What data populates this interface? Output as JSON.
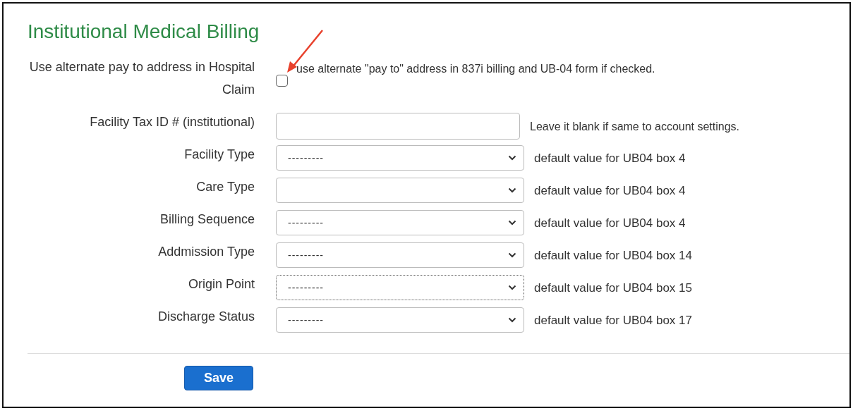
{
  "title": "Institutional Medical Billing",
  "fields": [
    {
      "kind": "checkbox",
      "label": "Use alternate pay to address in Hospital Claim",
      "checked": false,
      "hint": "use alternate \"pay to\" address in 837i billing and UB-04 form if checked."
    },
    {
      "kind": "text",
      "label": "Facility Tax ID # (institutional)",
      "hint": "Leave it blank if same to account settings."
    },
    {
      "kind": "select",
      "label": "Facility Type",
      "value": "---------",
      "focused": false,
      "hint": "default value for UB04 box 4"
    },
    {
      "kind": "select",
      "label": "Care Type",
      "focused": false,
      "hint": "default value for UB04 box 4"
    },
    {
      "kind": "select",
      "label": "Billing Sequence",
      "value": "---------",
      "focused": false,
      "hint": "default value for UB04 box 4"
    },
    {
      "kind": "select",
      "label": "Addmission Type",
      "value": "---------",
      "focused": false,
      "hint": "default value for UB04 box 14"
    },
    {
      "kind": "select",
      "label": "Origin Point",
      "value": "---------",
      "focused": true,
      "hint": "default value for UB04 box 15"
    },
    {
      "kind": "select",
      "label": "Discharge Status",
      "value": "---------",
      "focused": false,
      "hint": "default value for UB04 box 17"
    }
  ],
  "save_button": "Save"
}
